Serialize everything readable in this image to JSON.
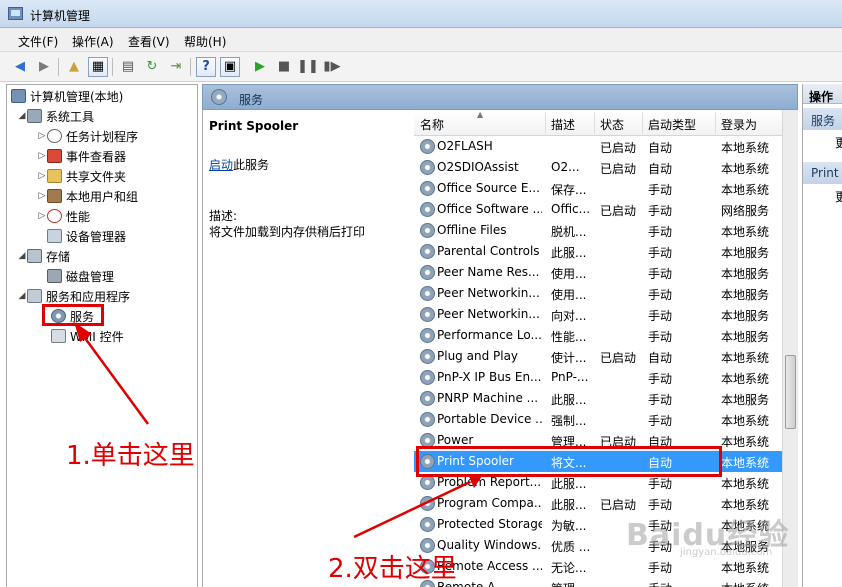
{
  "window": {
    "title": "计算机管理"
  },
  "menu": [
    "文件(F)",
    "操作(A)",
    "查看(V)",
    "帮助(H)"
  ],
  "tree": [
    {
      "label": "计算机管理(本地)",
      "icon": "computer-icon"
    },
    {
      "label": "系统工具",
      "icon": "tools-icon"
    },
    {
      "label": "任务计划程序",
      "icon": "clock-icon"
    },
    {
      "label": "事件查看器",
      "icon": "event-viewer-icon"
    },
    {
      "label": "共享文件夹",
      "icon": "folder-icon"
    },
    {
      "label": "本地用户和组",
      "icon": "users-icon"
    },
    {
      "label": "性能",
      "icon": "performance-icon"
    },
    {
      "label": "设备管理器",
      "icon": "device-manager-icon"
    },
    {
      "label": "存储",
      "icon": "storage-icon"
    },
    {
      "label": "磁盘管理",
      "icon": "disk-icon"
    },
    {
      "label": "服务和应用程序",
      "icon": "apps-icon"
    },
    {
      "label": "服务",
      "icon": "gear-icon"
    },
    {
      "label": "WMI 控件",
      "icon": "wmi-icon"
    }
  ],
  "center": {
    "header_title": "服务",
    "selected_service_title": "Print Spooler",
    "start_link": "启动",
    "start_suffix": "此服务",
    "description_label": "描述:",
    "description_text": "将文件加载到内存供稍后打印"
  },
  "columns": [
    "名称",
    "描述",
    "状态",
    "启动类型",
    "登录为"
  ],
  "services": [
    {
      "name": "O2FLASH",
      "desc": "",
      "status": "已启动",
      "startup": "自动",
      "logon": "本地系统"
    },
    {
      "name": "O2SDIOAssist",
      "desc": "O2...",
      "status": "已启动",
      "startup": "自动",
      "logon": "本地系统"
    },
    {
      "name": "Office  Source E...",
      "desc": "保存...",
      "status": "",
      "startup": "手动",
      "logon": "本地系统"
    },
    {
      "name": "Office Software ...",
      "desc": "Offic...",
      "status": "已启动",
      "startup": "手动",
      "logon": "网络服务"
    },
    {
      "name": "Offline Files",
      "desc": "脱机...",
      "status": "",
      "startup": "手动",
      "logon": "本地系统"
    },
    {
      "name": "Parental Controls",
      "desc": "此服...",
      "status": "",
      "startup": "手动",
      "logon": "本地服务"
    },
    {
      "name": "Peer Name Res...",
      "desc": "使用...",
      "status": "",
      "startup": "手动",
      "logon": "本地服务"
    },
    {
      "name": "Peer Networkin...",
      "desc": "使用...",
      "status": "",
      "startup": "手动",
      "logon": "本地服务"
    },
    {
      "name": "Peer Networkin...",
      "desc": "向对...",
      "status": "",
      "startup": "手动",
      "logon": "本地服务"
    },
    {
      "name": "Performance Lo...",
      "desc": "性能...",
      "status": "",
      "startup": "手动",
      "logon": "本地服务"
    },
    {
      "name": "Plug and Play",
      "desc": "使计...",
      "status": "已启动",
      "startup": "自动",
      "logon": "本地系统"
    },
    {
      "name": "PnP-X IP Bus En...",
      "desc": "PnP-...",
      "status": "",
      "startup": "手动",
      "logon": "本地系统"
    },
    {
      "name": "PNRP Machine ...",
      "desc": "此服...",
      "status": "",
      "startup": "手动",
      "logon": "本地服务"
    },
    {
      "name": "Portable Device ...",
      "desc": "强制...",
      "status": "",
      "startup": "手动",
      "logon": "本地系统"
    },
    {
      "name": "Power",
      "desc": "管理...",
      "status": "已启动",
      "startup": "自动",
      "logon": "本地系统"
    },
    {
      "name": "Print Spooler",
      "desc": "将文...",
      "status": "",
      "startup": "自动",
      "logon": "本地系统",
      "selected": true
    },
    {
      "name": "Problem Report...",
      "desc": "此服...",
      "status": "",
      "startup": "手动",
      "logon": "本地系统"
    },
    {
      "name": "Program Compa...",
      "desc": "此服...",
      "status": "已启动",
      "startup": "手动",
      "logon": "本地系统"
    },
    {
      "name": "Protected Storage",
      "desc": "为敏...",
      "status": "",
      "startup": "手动",
      "logon": "本地系统"
    },
    {
      "name": "Quality Windows...",
      "desc": "优质 ...",
      "status": "",
      "startup": "手动",
      "logon": "本地服务"
    },
    {
      "name": "Remote Access ...",
      "desc": "无论...",
      "status": "",
      "startup": "手动",
      "logon": "本地系统"
    },
    {
      "name": "Remote A...",
      "desc": "管理...",
      "status": "",
      "startup": "手动",
      "logon": "本地系统"
    }
  ],
  "actions": {
    "header": "操作",
    "section1": "服务",
    "section2": "Print",
    "more": "更"
  },
  "annotations": {
    "step1": "1.单击这里",
    "step2": "2.双击这里",
    "color": "#e00000"
  },
  "watermark": {
    "text": "Baidu经验",
    "sub": "jingyan.baidu.com"
  }
}
